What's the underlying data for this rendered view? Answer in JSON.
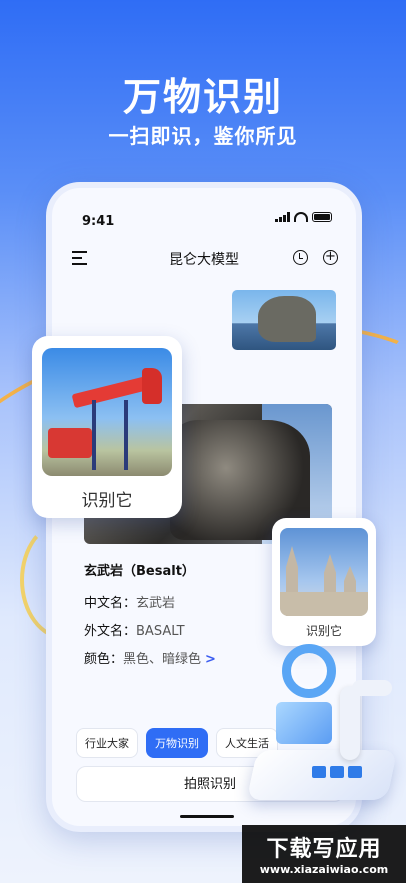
{
  "hero": {
    "title": "万物识别",
    "subtitle": "一扫即识，鉴你所见"
  },
  "status": {
    "time": "9:41"
  },
  "app": {
    "title": "昆仑大模型",
    "menu_icon": "menu-icon",
    "history_icon": "clock-icon",
    "new_icon": "plus-circle-icon"
  },
  "answer": {
    "title": "玄武岩（Besalt）",
    "rows": [
      {
        "key": "中文名：",
        "value": "玄武岩"
      },
      {
        "key": "外文名：",
        "value": "BASALT"
      },
      {
        "key": "颜色：",
        "value": "黑色、暗绿色"
      }
    ],
    "more": ">"
  },
  "chips": [
    "行业大家",
    "万物识别",
    "人文生活"
  ],
  "capture_button": "拍照识别",
  "cards": {
    "left_label": "识别它",
    "right_label": "识别它"
  },
  "watermark": {
    "main": "下载写应用",
    "url": "www.xiazaiwiao.com"
  },
  "colors": {
    "accent": "#2f6df5",
    "chevron": "#3a5cf0",
    "orbit": "#f3b24a"
  }
}
